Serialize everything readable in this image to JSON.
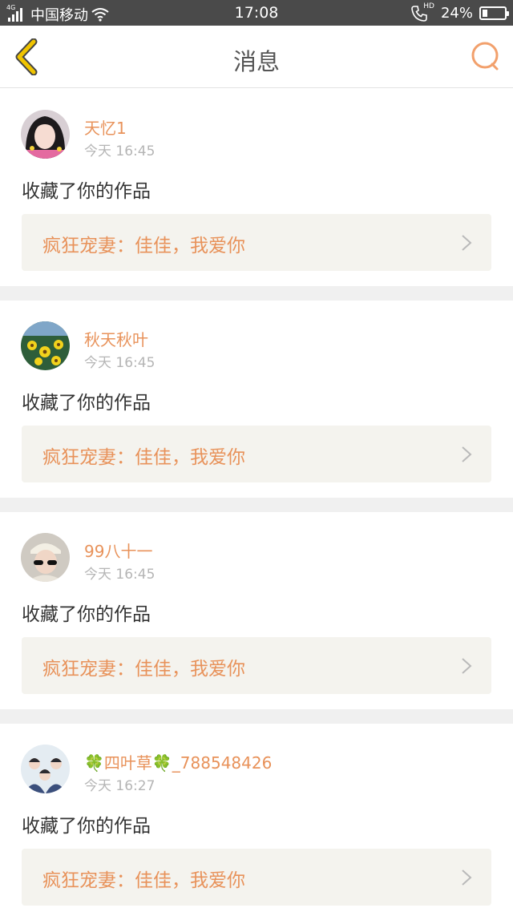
{
  "status_bar": {
    "network": "4G",
    "carrier": "中国移动",
    "time": "17:08",
    "call_badge": "HD",
    "battery": "24%",
    "battery_level": 0.24
  },
  "header": {
    "title": "消息",
    "back_icon": "chevron-left-icon",
    "search_icon": "search-icon",
    "accent_color": "#f0c400",
    "search_color": "#f2a06c"
  },
  "messages": [
    {
      "user": "天忆1",
      "time": "今天 16:45",
      "action": "收藏了你的作品",
      "work": "疯狂宠妻：佳佳，我爱你"
    },
    {
      "user": "秋天秋叶",
      "time": "今天 16:45",
      "action": "收藏了你的作品",
      "work": "疯狂宠妻：佳佳，我爱你"
    },
    {
      "user": "99八十一",
      "time": "今天 16:45",
      "action": "收藏了你的作品",
      "work": "疯狂宠妻：佳佳，我爱你"
    },
    {
      "user": "🍀四叶草🍀_788548426",
      "time": "今天 16:27",
      "action": "收藏了你的作品",
      "work": "疯狂宠妻：佳佳，我爱你"
    }
  ],
  "colors": {
    "name": "#e8925a",
    "time": "#b5b5b5",
    "box_bg": "#f4f3ee",
    "separator": "#f0f0f0"
  }
}
